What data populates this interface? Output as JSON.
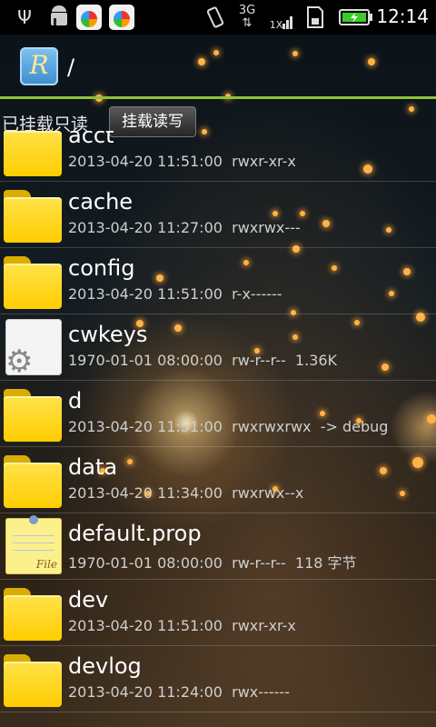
{
  "status_bar": {
    "icons": [
      "usb-icon",
      "android-debug-icon",
      "app-notification-icon",
      "app-notification-icon",
      "vibrate-icon",
      "network-3g-icon",
      "signal-icon",
      "sd-card-icon",
      "battery-charging-icon"
    ],
    "network_label": "3G",
    "signal_label": "1X",
    "time": "12:14"
  },
  "header": {
    "app_icon_letter": "R",
    "path": "/"
  },
  "mount_bar": {
    "status_label": "已挂载只读",
    "button_label": "挂载读写"
  },
  "files": [
    {
      "name": "acct",
      "date": "2013-04-20 11:51:00",
      "perms": "rwxr-xr-x",
      "extra": "",
      "icon": "folder-icon"
    },
    {
      "name": "cache",
      "date": "2013-04-20 11:27:00",
      "perms": "rwxrwx---",
      "extra": "",
      "icon": "folder-icon"
    },
    {
      "name": "config",
      "date": "2013-04-20 11:51:00",
      "perms": "r-x------",
      "extra": "",
      "icon": "folder-icon"
    },
    {
      "name": "cwkeys",
      "date": "1970-01-01 08:00:00",
      "perms": "rw-r--r--",
      "extra": "1.36K",
      "icon": "settings-file-icon"
    },
    {
      "name": "d",
      "date": "2013-04-20 11:51:00",
      "perms": "rwxrwxrwx",
      "extra": "-> debug",
      "icon": "folder-icon"
    },
    {
      "name": "data",
      "date": "2013-04-20 11:34:00",
      "perms": "rwxrwx--x",
      "extra": "",
      "icon": "folder-icon"
    },
    {
      "name": "default.prop",
      "date": "1970-01-01 08:00:00",
      "perms": "rw-r--r--",
      "extra": "118 字节",
      "icon": "text-file-icon"
    },
    {
      "name": "dev",
      "date": "2013-04-20 11:51:00",
      "perms": "rwxr-xr-x",
      "extra": "",
      "icon": "folder-icon"
    },
    {
      "name": "devlog",
      "date": "2013-04-20 11:24:00",
      "perms": "rwx------",
      "extra": "",
      "icon": "folder-icon"
    }
  ],
  "file_icon_tag": "File",
  "colors": {
    "accent_line": "#8fc23a",
    "folder": "#ffd400"
  }
}
